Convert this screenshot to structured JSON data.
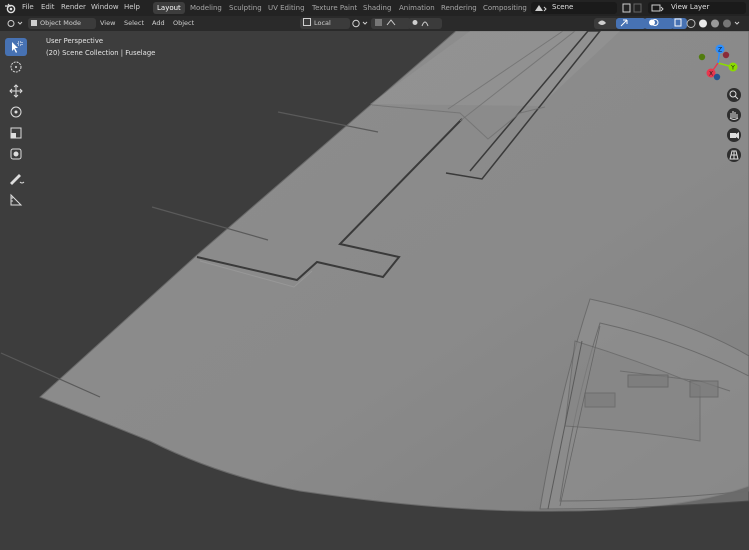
{
  "menu": {
    "items": [
      "File",
      "Edit",
      "Render",
      "Window",
      "Help"
    ]
  },
  "workspaces": {
    "tabs": [
      "Layout",
      "Modeling",
      "Sculpting",
      "UV Editing",
      "Texture Paint",
      "Shading",
      "Animation",
      "Rendering",
      "Compositing"
    ],
    "active": "Layout"
  },
  "scene": {
    "name": "Scene"
  },
  "view_layer": {
    "name": "View Layer"
  },
  "header": {
    "mode": "Object Mode",
    "menus": [
      "View",
      "Select",
      "Add",
      "Object"
    ],
    "transform_orientation": "Local"
  },
  "viewport": {
    "perspective": "User Perspective",
    "collection": "(20) Scene Collection | Fuselage"
  },
  "gizmo": {
    "x": "X",
    "y": "Y",
    "z": "Z"
  },
  "colors": {
    "accent": "#4772b3",
    "x_axis": "#e8384f",
    "y_axis": "#8bdc00",
    "z_axis": "#2c8fff"
  }
}
